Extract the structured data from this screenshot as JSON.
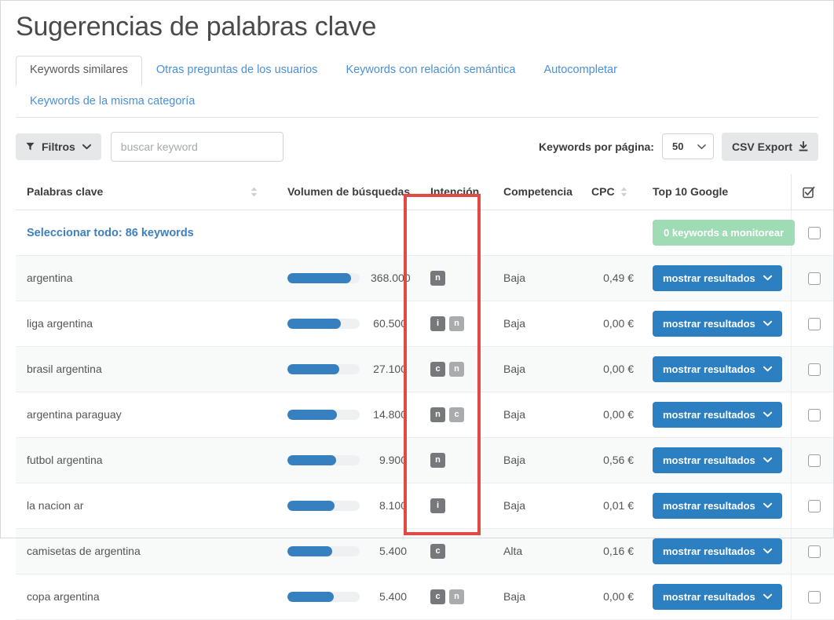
{
  "page": {
    "title": "Sugerencias de palabras clave"
  },
  "tabs": {
    "row1": [
      {
        "label": "Keywords similares",
        "active": true
      },
      {
        "label": "Otras preguntas de los usuarios",
        "active": false
      },
      {
        "label": "Keywords con relación semántica",
        "active": false
      },
      {
        "label": "Autocompletar",
        "active": false
      }
    ],
    "row2": [
      {
        "label": "Keywords de la misma categoría",
        "active": false
      }
    ]
  },
  "toolbar": {
    "filters_label": "Filtros",
    "filter_icon": "funnel-icon",
    "chevron_icon": "chevron-down-icon",
    "search_placeholder": "buscar keyword",
    "search_value": "",
    "per_page_label": "Keywords por página:",
    "per_page_value": "50",
    "per_page_options": [
      "50"
    ],
    "csv_export_label": "CSV Export",
    "csv_export_icon": "download-icon"
  },
  "table": {
    "headers": {
      "keyword": "Palabras clave",
      "volume": "Volumen de búsquedas",
      "intent": "Intención",
      "competition": "Competencia",
      "cpc": "CPC",
      "top10": "Top 10 Google",
      "check": "select-all-checkbox-icon"
    },
    "select_all": {
      "label": "Seleccionar todo: 86 keywords",
      "monitor_button": "0 keywords a monitorear",
      "monitor_color": "#9fdcb5"
    },
    "show_results_label": "mostrar resultados",
    "rows": [
      {
        "keyword": "argentina",
        "volume": "368.000",
        "bar_pct": 88,
        "intent": [
          "n"
        ],
        "competition": "Baja",
        "cpc": "0,49 €"
      },
      {
        "keyword": "liga argentina",
        "volume": "60.500",
        "bar_pct": 74,
        "intent": [
          "i",
          "n"
        ],
        "competition": "Baja",
        "cpc": "0,00 €"
      },
      {
        "keyword": "brasil argentina",
        "volume": "27.100",
        "bar_pct": 72,
        "intent": [
          "c",
          "n"
        ],
        "competition": "Baja",
        "cpc": "0,00 €"
      },
      {
        "keyword": "argentina paraguay",
        "volume": "14.800",
        "bar_pct": 69,
        "intent": [
          "n",
          "c"
        ],
        "competition": "Baja",
        "cpc": "0,00 €"
      },
      {
        "keyword": "futbol argentina",
        "volume": "9.900",
        "bar_pct": 67,
        "intent": [
          "n"
        ],
        "competition": "Baja",
        "cpc": "0,56 €"
      },
      {
        "keyword": "la nacion ar",
        "volume": "8.100",
        "bar_pct": 65,
        "intent": [
          "i"
        ],
        "competition": "Baja",
        "cpc": "0,01 €"
      },
      {
        "keyword": "camisetas de argentina",
        "volume": "5.400",
        "bar_pct": 62,
        "intent": [
          "c"
        ],
        "competition": "Alta",
        "cpc": "0,16 €"
      },
      {
        "keyword": "copa argentina",
        "volume": "5.400",
        "bar_pct": 64,
        "intent": [
          "c",
          "n"
        ],
        "competition": "Baja",
        "cpc": "0,00 €"
      }
    ]
  },
  "annotation": {
    "highlight_color": "#e04a42",
    "highlight_target": "intent-column"
  }
}
